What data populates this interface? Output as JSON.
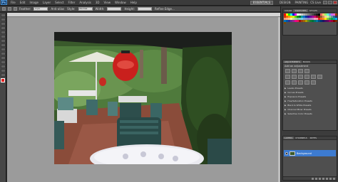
{
  "menubar": {
    "logo": "Ps",
    "items": [
      "File",
      "Edit",
      "Image",
      "Layer",
      "Select",
      "Filter",
      "Analysis",
      "3D",
      "View",
      "Window",
      "Help"
    ],
    "essentials": "ESSENTIALS",
    "design": "DESIGN",
    "painting": "PAINTING",
    "cs_live": "CS Live"
  },
  "options": {
    "feather_label": "Feather:",
    "feather_value": "0 px",
    "anti_alias": "Anti-alias",
    "style_label": "Style:",
    "style_value": "Normal",
    "width_label": "Width:",
    "height_label": "Height:",
    "refine": "Refine Edge..."
  },
  "document": {
    "tab_label": "table restaurant.jpg @ 25% (RGB/8)"
  },
  "colors": {
    "foreground": "#e02020",
    "background": "#ffffff",
    "layer_highlight": "#3d7bd0"
  },
  "swatches_panel": {
    "tabs": [
      "COLOR",
      "SWATCHES",
      "STYLES"
    ],
    "colors": [
      "#ff0000",
      "#ffff00",
      "#00ff00",
      "#00ffff",
      "#0000ff",
      "#ff00ff",
      "#ffffff",
      "#e6e6e6",
      "#cccccc",
      "#b3b3b3",
      "#999999",
      "#808080",
      "#666666",
      "#4d4d4d",
      "#333333",
      "#1a1a1a",
      "#000000",
      "#ff6666",
      "#ffcc66",
      "#99ff66",
      "#66ffcc",
      "#6699ff",
      "#cc66ff",
      "#ff66cc",
      "#993300",
      "#cc3300",
      "#ff6600",
      "#ff9900",
      "#ffcc00",
      "#ccff00",
      "#66cc00",
      "#009900",
      "#006633",
      "#009999",
      "#0066cc",
      "#003399",
      "#330099",
      "#660099",
      "#990099",
      "#cc0066",
      "#990033",
      "#663300",
      "#996633",
      "#cc9966",
      "#ffcc99",
      "#ccff99",
      "#99cc99",
      "#669999",
      "#336699",
      "#333366",
      "#f7977a",
      "#f9ad81",
      "#fdc68a",
      "#fff79a",
      "#c4df9b",
      "#a2d39c",
      "#82ca9d",
      "#7bcdc8",
      "#6ecff6",
      "#7ea7d8",
      "#8493ca",
      "#8882be",
      "#a187be",
      "#bc8dbf",
      "#f49ac2",
      "#f6989d",
      "#ed1c24",
      "#f26522",
      "#f7941d",
      "#fff200",
      "#8dc63f",
      "#39b54a",
      "#00a651",
      "#00a99d",
      "#00aeef",
      "#0072bc",
      "#0054a6",
      "#2e3192",
      "#662d91",
      "#92278f",
      "#ec008c",
      "#ed145b",
      "#9e0b0f",
      "#a0410d",
      "#a36209",
      "#aba000",
      "#598527",
      "#1a7b30",
      "#007236",
      "#00746b",
      "#0076a3",
      "#004b80",
      "#003471",
      "#1b1464",
      "#440e62",
      "#630460",
      "#9e005d",
      "#9e0039",
      "#790000",
      "#7b2e00",
      "#7d4900"
    ]
  },
  "adjustments_panel": {
    "tabs": [
      "ADJUSTMENTS",
      "MASKS"
    ],
    "title": "Add an adjustment",
    "presets": [
      "Levels Presets",
      "Curves Presets",
      "Exposure Presets",
      "Hue/Saturation Presets",
      "Black & White Presets",
      "Channel Mixer Presets",
      "Selective Color Presets"
    ]
  },
  "layers_panel": {
    "tabs": [
      "LAYERS",
      "CHANNELS",
      "PATHS"
    ],
    "layer_name": "Background"
  }
}
